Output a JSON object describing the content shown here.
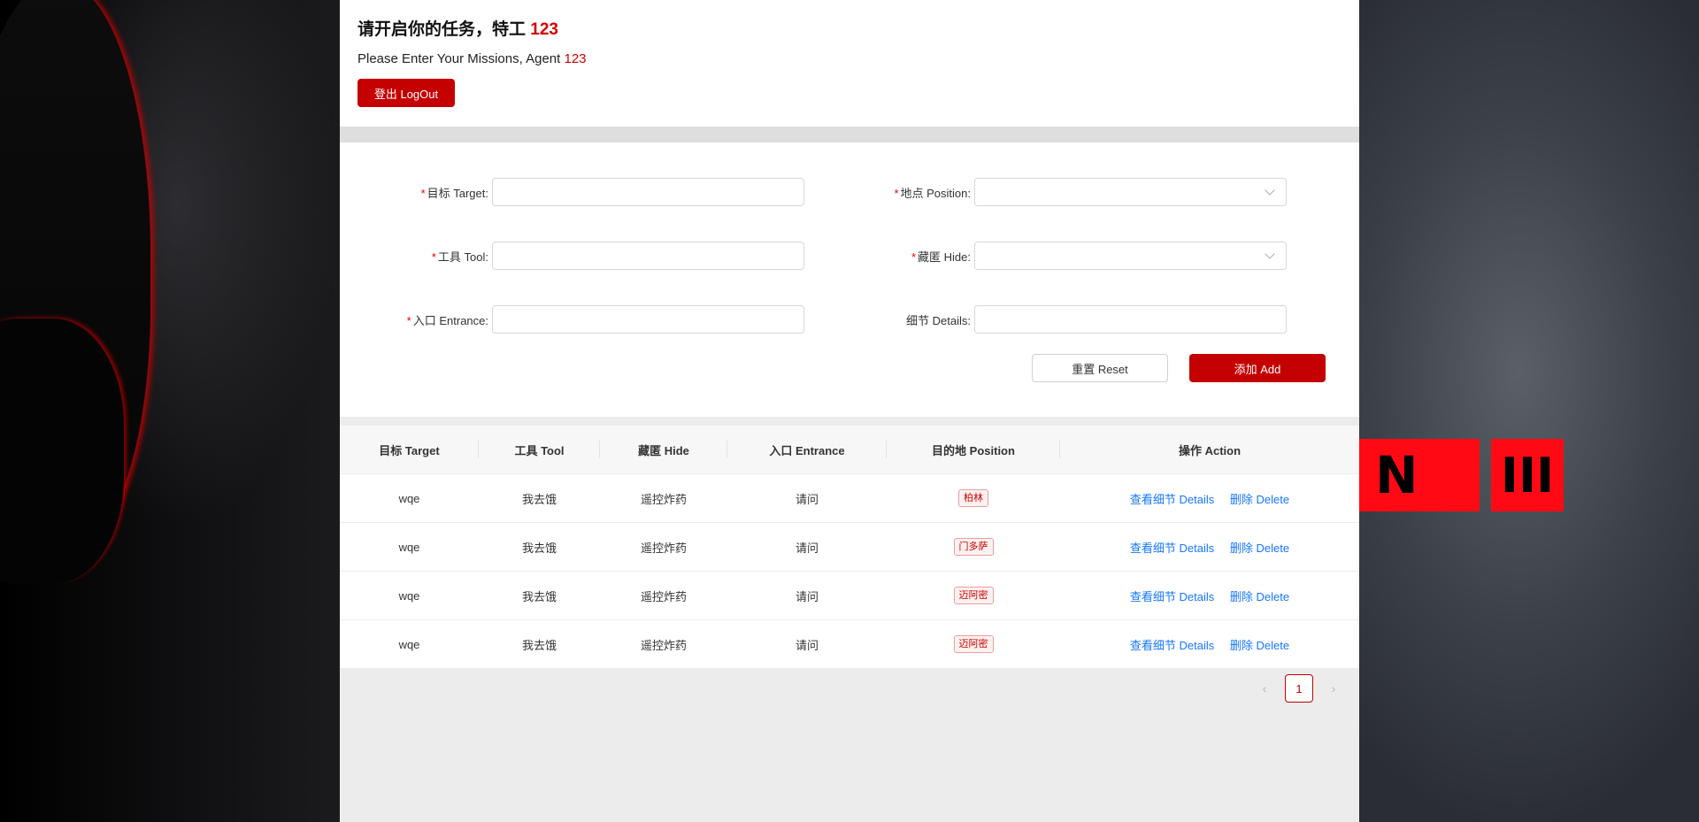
{
  "header": {
    "title": "请开启你的任务，特工",
    "agent_id": "123",
    "subtitle": "Please Enter Your Missions, Agent",
    "logout_label": "登出 LogOut"
  },
  "form": {
    "target_label": "目标 Target:",
    "position_label": "地点 Position:",
    "tool_label": "工具 Tool:",
    "hide_label": "藏匿 Hide:",
    "entrance_label": "入口 Entrance:",
    "details_label": "细节 Details:",
    "required_mark": "*",
    "reset_label": "重置 Reset",
    "add_label": "添加 Add"
  },
  "table": {
    "columns": [
      "目标 Target",
      "工具 Tool",
      "藏匿 Hide",
      "入口 Entrance",
      "目的地 Position",
      "操作 Action"
    ],
    "rows": [
      {
        "target": "wqe",
        "tool": "我去饿",
        "hide": "遥控炸药",
        "entrance": "请问",
        "position": "柏林"
      },
      {
        "target": "wqe",
        "tool": "我去饿",
        "hide": "遥控炸药",
        "entrance": "请问",
        "position": "门多萨"
      },
      {
        "target": "wqe",
        "tool": "我去饿",
        "hide": "遥控炸药",
        "entrance": "请问",
        "position": "迈阿密"
      },
      {
        "target": "wqe",
        "tool": "我去饿",
        "hide": "遥控炸药",
        "entrance": "请问",
        "position": "迈阿密"
      }
    ],
    "details_link": "查看细节 Details",
    "delete_link": "删除 Delete"
  },
  "pagination": {
    "prev": "‹",
    "current_page": "1",
    "next": "›"
  },
  "background": {
    "logo_left": "N",
    "logo_right": "III"
  },
  "colors": {
    "accent": "#c40000",
    "link": "#1677ff"
  }
}
